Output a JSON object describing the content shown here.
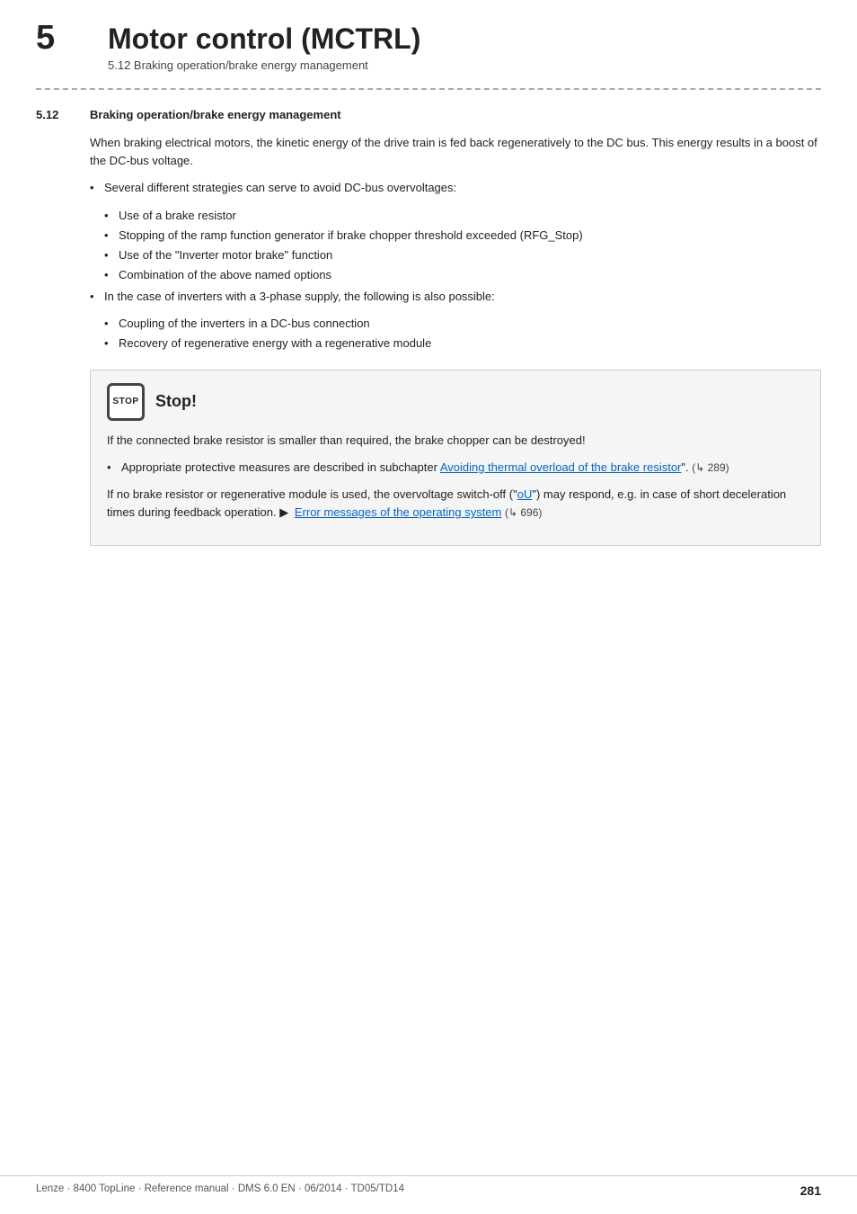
{
  "header": {
    "chapter_number": "5",
    "chapter_title": "Motor control (MCTRL)",
    "chapter_subtitle": "5.12        Braking operation/brake energy management"
  },
  "section": {
    "number": "5.12",
    "title": "Braking operation/brake energy management"
  },
  "intro_text": "When braking electrical motors, the kinetic energy of the drive train is fed back regeneratively to the DC bus. This energy results in a boost of the DC-bus voltage.",
  "bullet_groups": [
    {
      "main": "Several different strategies can serve to avoid DC-bus overvoltages:",
      "sub": [
        "Use of a brake resistor",
        "Stopping of the ramp function generator if brake chopper threshold exceeded (RFG_Stop)",
        "Use of the \"Inverter motor brake\" function",
        "Combination of the above named options"
      ]
    },
    {
      "main": "In the case of inverters with a 3-phase supply, the following is also possible:",
      "sub": [
        "Coupling of the inverters in a DC-bus connection",
        "Recovery of regenerative energy with a regenerative module"
      ]
    }
  ],
  "stop_box": {
    "icon_text": "STOP",
    "title": "Stop!",
    "paragraph1": "If the connected brake resistor is smaller than required, the brake chopper can be destroyed!",
    "bullet1_prefix": "Appropriate protective measures are described in subchapter ",
    "bullet1_link": "Avoiding thermal overload of the brake resistor",
    "bullet1_suffix": "\".",
    "bullet1_ref": "(↳ 289)",
    "paragraph2_prefix": "If no brake resistor or regenerative module is used, the overvoltage switch-off (\"",
    "paragraph2_link1": "oU",
    "paragraph2_link1_end": "\") may respond, e.g. in case of short deceleration times during feedback operation.",
    "paragraph2_arrow": "▶",
    "paragraph2_link2": "Error messages of the operating system",
    "paragraph2_ref": "(↳ 696)"
  },
  "footer": {
    "left": "Lenze · 8400 TopLine · Reference manual · DMS 6.0 EN · 06/2014 · TD05/TD14",
    "right": "281"
  }
}
